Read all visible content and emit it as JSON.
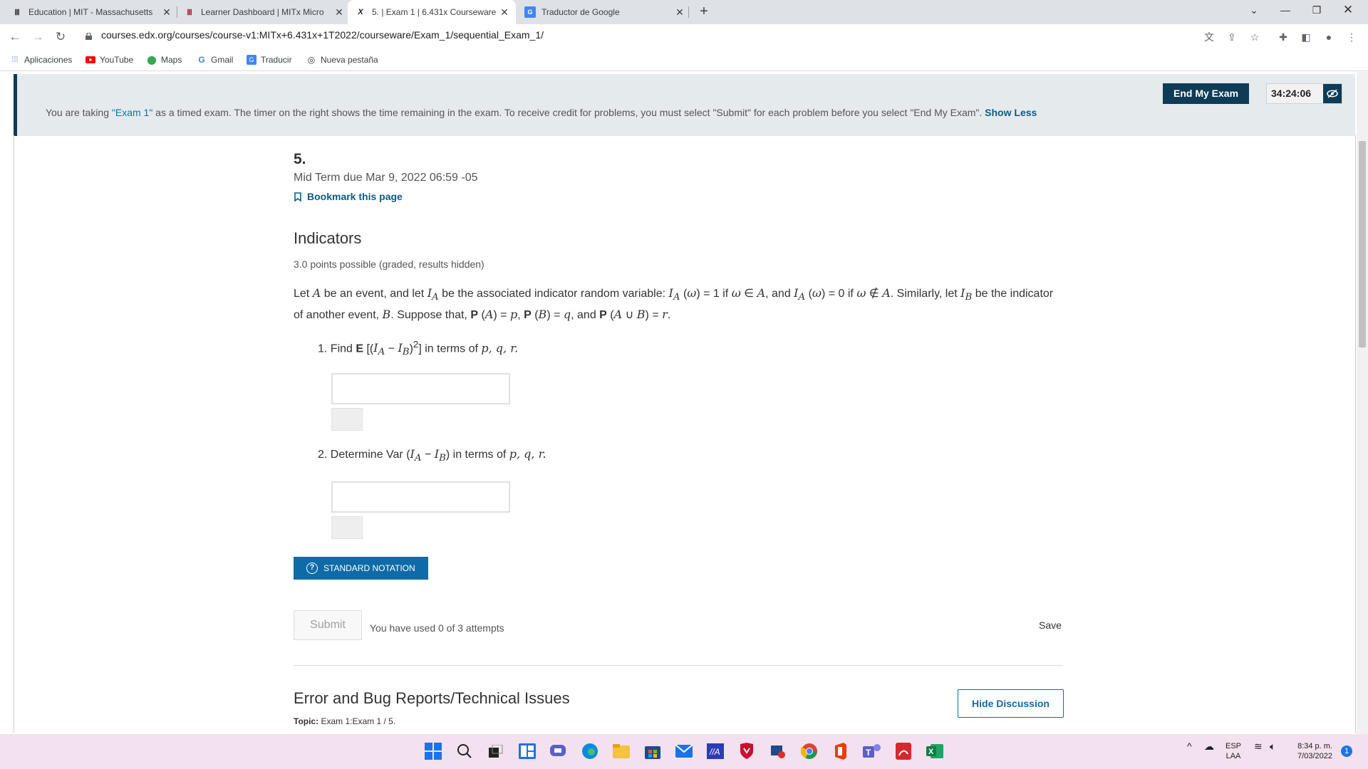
{
  "browser": {
    "tabs": [
      {
        "title": "Education | MIT - Massachusetts",
        "icon": "mit-icon",
        "active": false
      },
      {
        "title": "Learner Dashboard | MITx Micro",
        "icon": "mit-icon",
        "active": false
      },
      {
        "title": "5. | Exam 1 | 6.431x Courseware |",
        "icon": "edx-icon",
        "active": true
      },
      {
        "title": "Traductor de Google",
        "icon": "translate-icon",
        "active": false
      }
    ],
    "url": "courses.edx.org/courses/course-v1:MITx+6.431x+1T2022/courseware/Exam_1/sequential_Exam_1/",
    "bookmarks": [
      {
        "label": "Aplicaciones",
        "icon": "apps-grid-icon"
      },
      {
        "label": "YouTube",
        "icon": "youtube-icon"
      },
      {
        "label": "Maps",
        "icon": "maps-pin-icon"
      },
      {
        "label": "Gmail",
        "icon": "google-g-icon"
      },
      {
        "label": "Traducir",
        "icon": "translate-icon"
      },
      {
        "label": "Nueva pestaña",
        "icon": "globe-icon"
      }
    ]
  },
  "exam_banner": {
    "text_prefix": "You are taking ",
    "exam_name": "\"Exam 1\"",
    "text_suffix": " as a timed exam. The timer on the right shows the time remaining in the exam. To receive credit for problems, you must select \"Submit\" for each problem before you select \"End My Exam\".",
    "show_less": "Show Less",
    "end_button": "End My Exam",
    "timer": "34:24:06"
  },
  "unit": {
    "number": "5.",
    "due": "Mid Term due Mar 9, 2022 06:59 -05",
    "bookmark_label": "Bookmark this page"
  },
  "problem": {
    "title": "Indicators",
    "points": "3.0 points possible (graded, results hidden)",
    "q1_prefix": "1. Find ",
    "q1_suffix": " in terms of ",
    "q2_prefix": "2. Determine ",
    "q2_suffix": " in terms of ",
    "pqr": "p, q, r.",
    "notation_button": "STANDARD NOTATION",
    "submit_label": "Submit",
    "attempts": "You have used 0 of 3 attempts",
    "save_label": "Save"
  },
  "discussion": {
    "title": "Error and Bug Reports/Technical Issues",
    "topic_label": "Topic:",
    "topic_value": "Exam 1:Exam 1 / 5.",
    "hide_button": "Hide Discussion"
  },
  "taskbar": {
    "lang_top": "ESP",
    "lang_bottom": "LAA",
    "time": "8:34 p. m.",
    "date": "7/03/2022",
    "notification_count": "1"
  }
}
